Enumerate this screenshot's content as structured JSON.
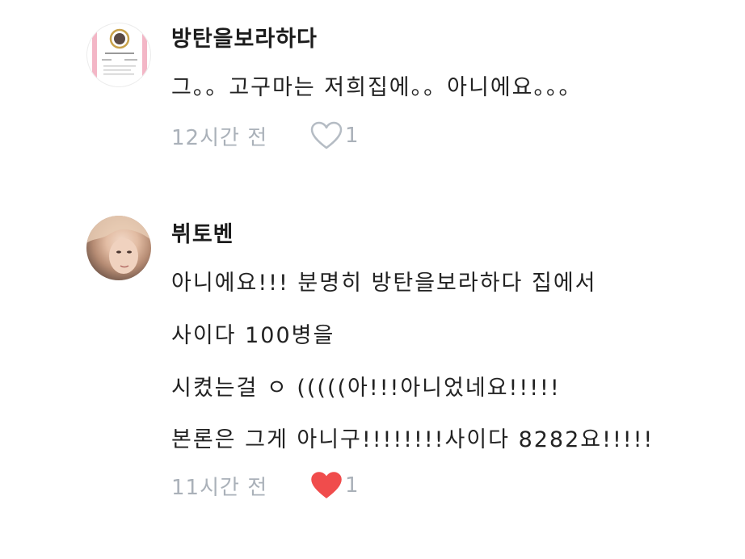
{
  "comments": [
    {
      "username": "방탄을보라하다",
      "lines": [
        "그。。고구마는 저희집에。。아니에요。。。"
      ],
      "time": "12시간 전",
      "likes": "1",
      "liked": false,
      "avatar_icon": "profile-badge-icon"
    },
    {
      "username": "뷔토벤",
      "lines": [
        "아니에요!!! 분명히 방탄을보라하다 집에서",
        "사이다 100병을",
        "시켰는걸 ㅇ (((((아!!!아니었네요!!!!!",
        "본론은 그게 아니구!!!!!!!!사이다 8282요!!!!!"
      ],
      "time": "11시간 전",
      "likes": "1",
      "liked": true,
      "avatar_icon": "profile-photo-icon"
    }
  ],
  "colors": {
    "meta_text": "#aab1b9",
    "heart_outline": "#b5bcc4",
    "heart_filled": "#f04c4c"
  }
}
